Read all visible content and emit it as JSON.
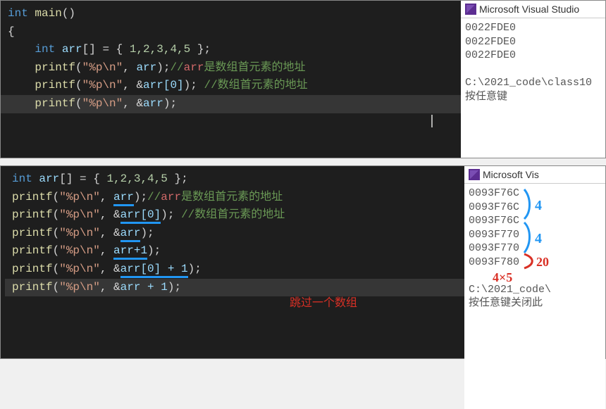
{
  "top": {
    "code": {
      "l1": {
        "kw1": "int",
        "fn": " main",
        "rest": "()"
      },
      "l2": "{",
      "l3": {
        "indent": "    ",
        "kw": "int",
        "id": " arr",
        "brackets": "[] ",
        "eq": "= { ",
        "nums": "1,2,3,4,5",
        "end": " };"
      },
      "l4": {
        "indent": "    ",
        "fn": "printf",
        "open": "(",
        "str": "\"%p\\n\"",
        "comma": ", ",
        "arg": "arr",
        "close": ");",
        "cmt_pre": "//",
        "arr_red": "arr",
        "cmt_rest": "是数组首元素的地址"
      },
      "l5": {
        "indent": "    ",
        "fn": "printf",
        "open": "(",
        "str": "\"%p\\n\"",
        "comma": ", ",
        "amp": "&",
        "arg": "arr[0]",
        "close": "); ",
        "cmt": "//数组首元素的地址"
      },
      "l6": {
        "indent": "    ",
        "fn": "printf",
        "open": "(",
        "str": "\"%p\\n\"",
        "comma": ", ",
        "amp": "&",
        "arg": "arr",
        "close": ");"
      }
    },
    "output": {
      "title": "Microsoft Visual Studio",
      "lines": [
        "0022FDE0",
        "0022FDE0",
        "0022FDE0",
        "",
        "C:\\2021_code\\class10",
        "按任意键"
      ]
    }
  },
  "bottom": {
    "code": {
      "l1": {
        "kw": "int",
        "id": " arr",
        "brackets": "[] ",
        "eq": "= { ",
        "nums": "1,2,3,4,5",
        "end": " };"
      },
      "l2": {
        "fn": "printf",
        "open": "(",
        "str": "\"%p\\n\"",
        "comma": ", ",
        "arg": "arr",
        "close": ");",
        "cmt_pre": "//",
        "arr_red": "arr",
        "cmt_rest": "是数组首元素的地址"
      },
      "l3": {
        "fn": "printf",
        "open": "(",
        "str": "\"%p\\n\"",
        "comma": ", ",
        "amp": "&",
        "arg": "arr[0]",
        "close": "); ",
        "cmt": "//数组首元素的地址"
      },
      "l4": {
        "fn": "printf",
        "open": "(",
        "str": "\"%p\\n\"",
        "comma": ", ",
        "amp": "&",
        "arg": "arr",
        "close": ");"
      },
      "blank": "",
      "l5": {
        "fn": "printf",
        "open": "(",
        "str": "\"%p\\n\"",
        "comma": ", ",
        "arg": "arr+1",
        "close": ");"
      },
      "l6": {
        "fn": "printf",
        "open": "(",
        "str": "\"%p\\n\"",
        "comma": ", ",
        "amp": "&",
        "arg": "arr[0] + 1",
        "close": ");"
      },
      "l7": {
        "fn": "printf",
        "open": "(",
        "str": "\"%p\\n\"",
        "comma": ", ",
        "amp": "&",
        "arg": "arr + 1",
        "close": ");"
      }
    },
    "annotation": {
      "skip_array": "跳过一个数组"
    },
    "output": {
      "title": "Microsoft Vis",
      "lines": [
        "0093F76C",
        "0093F76C",
        "0093F76C",
        "0093F770",
        "0093F770",
        "0093F780",
        "",
        "C:\\2021_code\\",
        "按任意键关闭此"
      ]
    },
    "handwriting": {
      "b1": "4",
      "b2": "4",
      "r1": "20",
      "r2": "4×5"
    }
  }
}
